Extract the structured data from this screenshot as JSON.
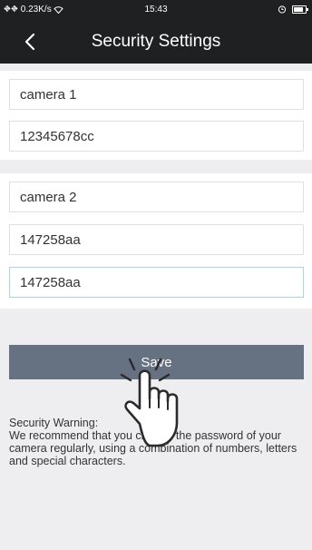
{
  "status_bar": {
    "signal": "⛖⛖ 0.23K/s",
    "time": "15:43",
    "icons": [
      "signal-icon",
      "wifi-icon",
      "alarm-icon",
      "battery-icon"
    ]
  },
  "header": {
    "title": "Security Settings",
    "back_icon": "chevron-left-icon"
  },
  "cameras": [
    {
      "name": "camera 1",
      "password": "12345678cc"
    },
    {
      "name": "camera 2",
      "password": "147258aa",
      "confirm_password": "147258aa"
    }
  ],
  "save_label": "Save",
  "warning": {
    "title": "Security Warning:",
    "body": "We recommend that you change the password of your camera regularly, using a combination of numbers, letters and special characters."
  },
  "colors": {
    "header_bg": "#1f2022",
    "page_bg": "#eeeef0",
    "save_bg": "#667182",
    "focus_border": "#a8d4ec"
  }
}
